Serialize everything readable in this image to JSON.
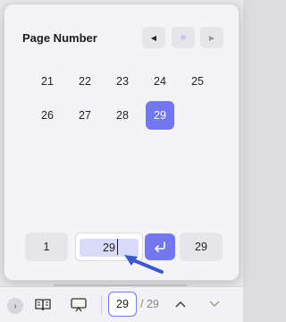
{
  "popup": {
    "title": "Page Number",
    "nav": {
      "prev_icon": "triangle-left-icon",
      "current_icon": "dot-icon",
      "next_icon": "triangle-right-icon"
    },
    "pages": [
      {
        "label": "21",
        "selected": false
      },
      {
        "label": "22",
        "selected": false
      },
      {
        "label": "23",
        "selected": false
      },
      {
        "label": "24",
        "selected": false
      },
      {
        "label": "25",
        "selected": false
      },
      {
        "label": "26",
        "selected": false
      },
      {
        "label": "27",
        "selected": false
      },
      {
        "label": "28",
        "selected": false
      },
      {
        "label": "29",
        "selected": true
      }
    ],
    "first_page": "1",
    "page_input_value": "29",
    "last_page": "29",
    "enter_icon": "return-arrow-icon",
    "accent_color": "#7277f2"
  },
  "toolbar": {
    "expand_icon": "chevron-right-icon",
    "reader_icon": "book-icon",
    "present_icon": "projector-icon",
    "current_page": "29",
    "total_pages": "/ 29",
    "up_icon": "chevron-up-icon",
    "down_icon": "chevron-down-icon"
  }
}
